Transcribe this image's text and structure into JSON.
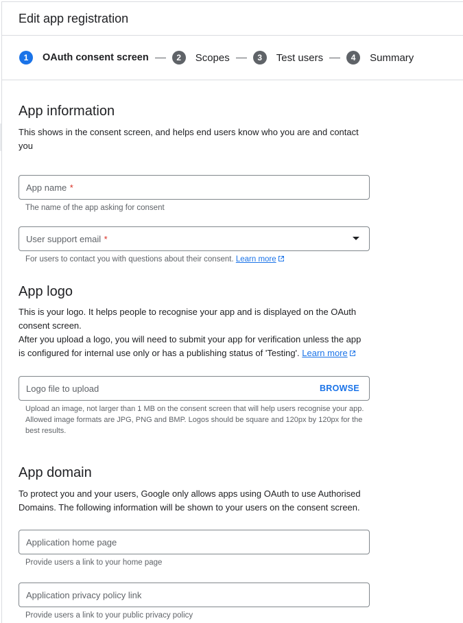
{
  "header": {
    "title": "Edit app registration"
  },
  "stepper": {
    "steps": [
      {
        "num": "1",
        "label": "OAuth consent screen",
        "active": true
      },
      {
        "num": "2",
        "label": "Scopes"
      },
      {
        "num": "3",
        "label": "Test users"
      },
      {
        "num": "4",
        "label": "Summary"
      }
    ]
  },
  "app_information": {
    "title": "App information",
    "description": "This shows in the consent screen, and helps end users know who you are and contact you",
    "app_name": {
      "placeholder": "App name",
      "required_mark": "*",
      "hint": "The name of the app asking for consent"
    },
    "support_email": {
      "placeholder": "User support email",
      "required_mark": "*",
      "hint": "For users to contact you with questions about their consent.",
      "learn_more": "Learn more"
    }
  },
  "app_logo": {
    "title": "App logo",
    "description_1": "This is your logo. It helps people to recognise your app and is displayed on the OAuth consent screen.",
    "description_2": "After you upload a logo, you will need to submit your app for verification unless the app is configured for internal use only or has a publishing status of 'Testing'.",
    "learn_more": "Learn more",
    "upload": {
      "placeholder": "Logo file to upload",
      "browse_label": "BROWSE"
    },
    "hint": "Upload an image, not larger than 1 MB on the consent screen that will help users recognise your app. Allowed image formats are JPG, PNG and BMP. Logos should be square and 120px by 120px for the best results."
  },
  "app_domain": {
    "title": "App domain",
    "description": "To protect you and your users, Google only allows apps using OAuth to use Authorised Domains. The following information will be shown to your users on the consent screen.",
    "home_page": {
      "placeholder": "Application home page",
      "hint": "Provide users a link to your home page"
    },
    "privacy_policy": {
      "placeholder": "Application privacy policy link",
      "hint": "Provide users a link to your public privacy policy"
    }
  }
}
